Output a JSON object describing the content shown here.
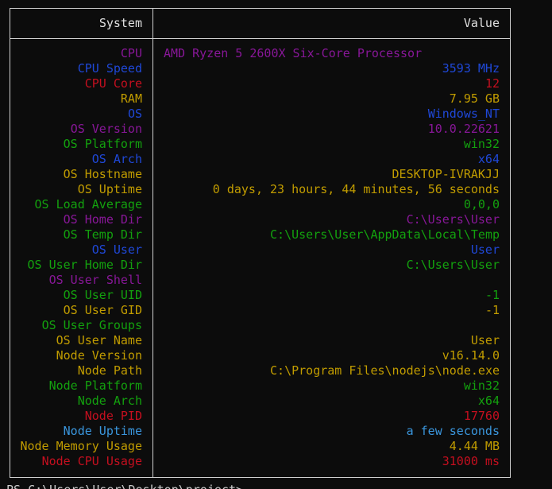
{
  "colors": {
    "purple": "#881798",
    "blue": "#1f48d8",
    "red": "#c50f1f",
    "yellow": "#c19c00",
    "green": "#13a10e",
    "cyan": "#3a96dd",
    "border": "#d0d0d0",
    "background": "#0c0c0c"
  },
  "table": {
    "header_key": "System",
    "header_value": "Value",
    "rows": [
      {
        "key": "CPU",
        "value": "AMD Ryzen 5 2600X Six-Core Processor",
        "color": "purple",
        "align": "left"
      },
      {
        "key": "CPU Speed",
        "value": "3593 MHz",
        "color": "blue"
      },
      {
        "key": "CPU Core",
        "value": "12",
        "color": "red"
      },
      {
        "key": "RAM",
        "value": "7.95 GB",
        "color": "yellow"
      },
      {
        "key": "OS",
        "value": "Windows_NT",
        "color": "blue"
      },
      {
        "key": "OS Version",
        "value": "10.0.22621",
        "color": "purple"
      },
      {
        "key": "OS Platform",
        "value": "win32",
        "color": "green"
      },
      {
        "key": "OS Arch",
        "value": "x64",
        "color": "blue"
      },
      {
        "key": "OS Hostname",
        "value": "DESKTOP-IVRAKJJ",
        "color": "yellow"
      },
      {
        "key": "OS Uptime",
        "value": "0 days, 23 hours, 44 minutes, 56 seconds",
        "color": "yellow"
      },
      {
        "key": "OS Load Average",
        "value": "0,0,0",
        "color": "green"
      },
      {
        "key": "OS Home Dir",
        "value": "C:\\Users\\User",
        "color": "purple"
      },
      {
        "key": "OS Temp Dir",
        "value": "C:\\Users\\User\\AppData\\Local\\Temp",
        "color": "green"
      },
      {
        "key": "OS User",
        "value": "User",
        "color": "blue"
      },
      {
        "key": "OS User Home Dir",
        "value": "C:\\Users\\User",
        "color": "green"
      },
      {
        "key": "OS User Shell",
        "value": "",
        "color": "purple"
      },
      {
        "key": "OS User UID",
        "value": "-1",
        "color": "green"
      },
      {
        "key": "OS User GID",
        "value": "-1",
        "color": "yellow"
      },
      {
        "key": "OS User Groups",
        "value": "",
        "color": "green"
      },
      {
        "key": "OS User Name",
        "value": "User",
        "color": "yellow"
      },
      {
        "key": "Node Version",
        "value": "v16.14.0",
        "color": "yellow"
      },
      {
        "key": "Node Path",
        "value": "C:\\Program Files\\nodejs\\node.exe",
        "color": "yellow"
      },
      {
        "key": "Node Platform",
        "value": "win32",
        "color": "green"
      },
      {
        "key": "Node Arch",
        "value": "x64",
        "color": "green"
      },
      {
        "key": "Node PID",
        "value": "17760",
        "color": "red"
      },
      {
        "key": "Node Uptime",
        "value": "a few seconds",
        "color": "cyan"
      },
      {
        "key": "Node Memory Usage",
        "value": "4.44 MB",
        "color": "yellow"
      },
      {
        "key": "Node CPU Usage",
        "value": "31000 ms",
        "color": "red"
      }
    ]
  },
  "prompt": "PS C:\\Users\\User\\Desktop\\project> "
}
